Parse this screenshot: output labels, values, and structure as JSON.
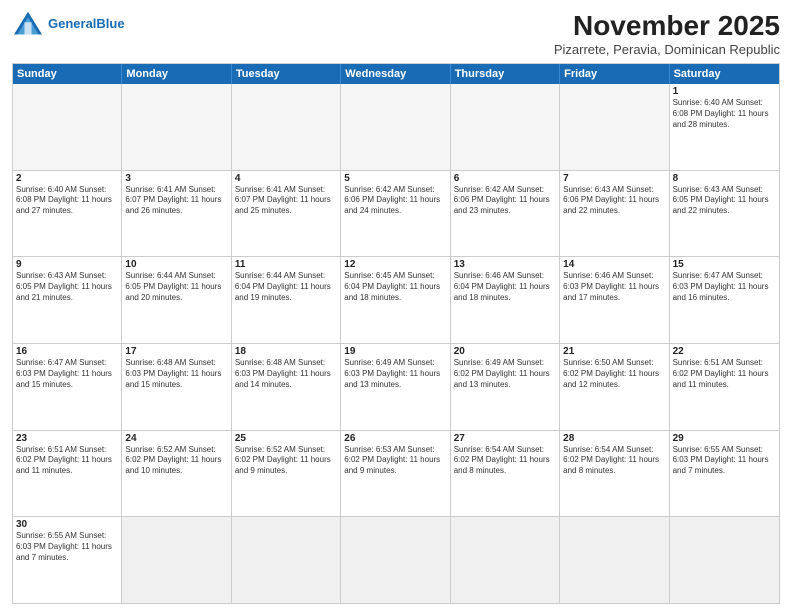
{
  "header": {
    "logo_general": "General",
    "logo_blue": "Blue",
    "month_title": "November 2025",
    "location": "Pizarrete, Peravia, Dominican Republic"
  },
  "day_headers": [
    "Sunday",
    "Monday",
    "Tuesday",
    "Wednesday",
    "Thursday",
    "Friday",
    "Saturday"
  ],
  "weeks": [
    {
      "days": [
        {
          "num": "",
          "info": "",
          "empty": true
        },
        {
          "num": "",
          "info": "",
          "empty": true
        },
        {
          "num": "",
          "info": "",
          "empty": true
        },
        {
          "num": "",
          "info": "",
          "empty": true
        },
        {
          "num": "",
          "info": "",
          "empty": true
        },
        {
          "num": "",
          "info": "",
          "empty": true
        },
        {
          "num": "1",
          "info": "Sunrise: 6:40 AM\nSunset: 6:08 PM\nDaylight: 11 hours\nand 28 minutes.",
          "empty": false
        }
      ]
    },
    {
      "days": [
        {
          "num": "2",
          "info": "Sunrise: 6:40 AM\nSunset: 6:08 PM\nDaylight: 11 hours\nand 27 minutes.",
          "empty": false
        },
        {
          "num": "3",
          "info": "Sunrise: 6:41 AM\nSunset: 6:07 PM\nDaylight: 11 hours\nand 26 minutes.",
          "empty": false
        },
        {
          "num": "4",
          "info": "Sunrise: 6:41 AM\nSunset: 6:07 PM\nDaylight: 11 hours\nand 25 minutes.",
          "empty": false
        },
        {
          "num": "5",
          "info": "Sunrise: 6:42 AM\nSunset: 6:06 PM\nDaylight: 11 hours\nand 24 minutes.",
          "empty": false
        },
        {
          "num": "6",
          "info": "Sunrise: 6:42 AM\nSunset: 6:06 PM\nDaylight: 11 hours\nand 23 minutes.",
          "empty": false
        },
        {
          "num": "7",
          "info": "Sunrise: 6:43 AM\nSunset: 6:06 PM\nDaylight: 11 hours\nand 22 minutes.",
          "empty": false
        },
        {
          "num": "8",
          "info": "Sunrise: 6:43 AM\nSunset: 6:05 PM\nDaylight: 11 hours\nand 22 minutes.",
          "empty": false
        }
      ]
    },
    {
      "days": [
        {
          "num": "9",
          "info": "Sunrise: 6:43 AM\nSunset: 6:05 PM\nDaylight: 11 hours\nand 21 minutes.",
          "empty": false
        },
        {
          "num": "10",
          "info": "Sunrise: 6:44 AM\nSunset: 6:05 PM\nDaylight: 11 hours\nand 20 minutes.",
          "empty": false
        },
        {
          "num": "11",
          "info": "Sunrise: 6:44 AM\nSunset: 6:04 PM\nDaylight: 11 hours\nand 19 minutes.",
          "empty": false
        },
        {
          "num": "12",
          "info": "Sunrise: 6:45 AM\nSunset: 6:04 PM\nDaylight: 11 hours\nand 18 minutes.",
          "empty": false
        },
        {
          "num": "13",
          "info": "Sunrise: 6:46 AM\nSunset: 6:04 PM\nDaylight: 11 hours\nand 18 minutes.",
          "empty": false
        },
        {
          "num": "14",
          "info": "Sunrise: 6:46 AM\nSunset: 6:03 PM\nDaylight: 11 hours\nand 17 minutes.",
          "empty": false
        },
        {
          "num": "15",
          "info": "Sunrise: 6:47 AM\nSunset: 6:03 PM\nDaylight: 11 hours\nand 16 minutes.",
          "empty": false
        }
      ]
    },
    {
      "days": [
        {
          "num": "16",
          "info": "Sunrise: 6:47 AM\nSunset: 6:03 PM\nDaylight: 11 hours\nand 15 minutes.",
          "empty": false
        },
        {
          "num": "17",
          "info": "Sunrise: 6:48 AM\nSunset: 6:03 PM\nDaylight: 11 hours\nand 15 minutes.",
          "empty": false
        },
        {
          "num": "18",
          "info": "Sunrise: 6:48 AM\nSunset: 6:03 PM\nDaylight: 11 hours\nand 14 minutes.",
          "empty": false
        },
        {
          "num": "19",
          "info": "Sunrise: 6:49 AM\nSunset: 6:03 PM\nDaylight: 11 hours\nand 13 minutes.",
          "empty": false
        },
        {
          "num": "20",
          "info": "Sunrise: 6:49 AM\nSunset: 6:02 PM\nDaylight: 11 hours\nand 13 minutes.",
          "empty": false
        },
        {
          "num": "21",
          "info": "Sunrise: 6:50 AM\nSunset: 6:02 PM\nDaylight: 11 hours\nand 12 minutes.",
          "empty": false
        },
        {
          "num": "22",
          "info": "Sunrise: 6:51 AM\nSunset: 6:02 PM\nDaylight: 11 hours\nand 11 minutes.",
          "empty": false
        }
      ]
    },
    {
      "days": [
        {
          "num": "23",
          "info": "Sunrise: 6:51 AM\nSunset: 6:02 PM\nDaylight: 11 hours\nand 11 minutes.",
          "empty": false
        },
        {
          "num": "24",
          "info": "Sunrise: 6:52 AM\nSunset: 6:02 PM\nDaylight: 11 hours\nand 10 minutes.",
          "empty": false
        },
        {
          "num": "25",
          "info": "Sunrise: 6:52 AM\nSunset: 6:02 PM\nDaylight: 11 hours\nand 9 minutes.",
          "empty": false
        },
        {
          "num": "26",
          "info": "Sunrise: 6:53 AM\nSunset: 6:02 PM\nDaylight: 11 hours\nand 9 minutes.",
          "empty": false
        },
        {
          "num": "27",
          "info": "Sunrise: 6:54 AM\nSunset: 6:02 PM\nDaylight: 11 hours\nand 8 minutes.",
          "empty": false
        },
        {
          "num": "28",
          "info": "Sunrise: 6:54 AM\nSunset: 6:02 PM\nDaylight: 11 hours\nand 8 minutes.",
          "empty": false
        },
        {
          "num": "29",
          "info": "Sunrise: 6:55 AM\nSunset: 6:03 PM\nDaylight: 11 hours\nand 7 minutes.",
          "empty": false
        }
      ]
    },
    {
      "days": [
        {
          "num": "30",
          "info": "Sunrise: 6:55 AM\nSunset: 6:03 PM\nDaylight: 11 hours\nand 7 minutes.",
          "empty": false
        },
        {
          "num": "",
          "info": "",
          "empty": true,
          "last": true
        },
        {
          "num": "",
          "info": "",
          "empty": true,
          "last": true
        },
        {
          "num": "",
          "info": "",
          "empty": true,
          "last": true
        },
        {
          "num": "",
          "info": "",
          "empty": true,
          "last": true
        },
        {
          "num": "",
          "info": "",
          "empty": true,
          "last": true
        },
        {
          "num": "",
          "info": "",
          "empty": true,
          "last": true
        }
      ]
    }
  ]
}
